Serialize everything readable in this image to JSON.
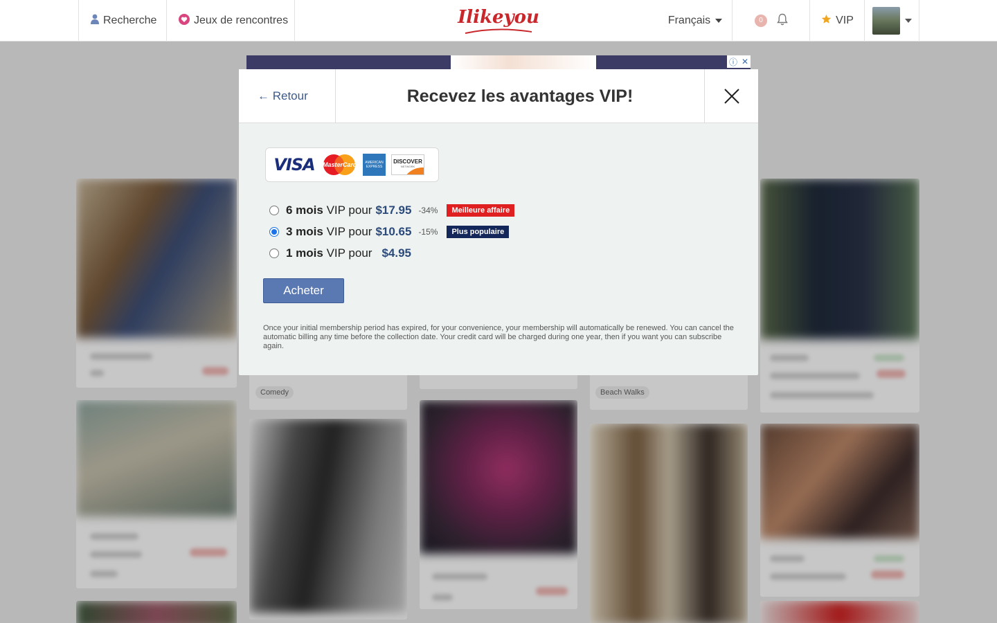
{
  "header": {
    "nav_search": "Recherche",
    "nav_games": "Jeux de rencontres",
    "logo": "Ilikeyou",
    "language": "Français",
    "notification_count": "0",
    "vip": "VIP"
  },
  "background": {
    "tags": [
      "Comedy",
      "Beach Walks"
    ],
    "partial_text": [
      "Nurnberg",
      "Berlin"
    ]
  },
  "modal": {
    "back_label": "← Retour",
    "title": "Recevez les avantages VIP!",
    "card_brands": {
      "visa": "VISA",
      "mastercard": "MasterCard",
      "amex": "AMERICAN EXPRESS",
      "discover": "DISCOVER",
      "discover_sub": "NETWORK"
    },
    "plans": [
      {
        "months": "6 mois",
        "text": "VIP pour",
        "price": "$17.95",
        "discount": "-34%",
        "badge": "Meilleure affaire",
        "selected": false
      },
      {
        "months": "3 mois",
        "text": "VIP pour",
        "price": "$10.65",
        "discount": "-15%",
        "badge": "Plus populaire",
        "selected": true
      },
      {
        "months": "1 mois",
        "text": "VIP pour",
        "price": "$4.95",
        "discount": "",
        "badge": "",
        "selected": false
      }
    ],
    "buy_label": "Acheter",
    "legal": "Once your initial membership period has expired, for your convenience, your membership will automatically be renewed. You can cancel the automatic billing any time before the collection date. Your credit card will be charged during one year, then if you want you can subscribe again."
  },
  "colors": {
    "brand_red": "#c8282c",
    "best_deal": "#e02020",
    "popular": "#14275a",
    "buy_button": "#5a79b3"
  }
}
